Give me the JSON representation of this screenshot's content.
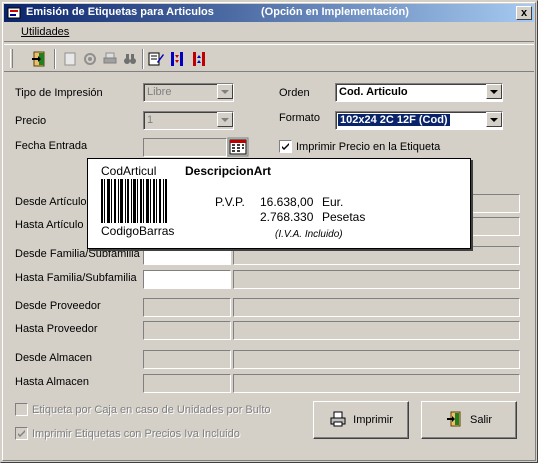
{
  "window": {
    "title": "Emisión de Etiquetas para Articulos",
    "subtitle": "(Opción en Implementación)",
    "close_label": "x"
  },
  "menu": {
    "utilidades": "Utilidades"
  },
  "toolbar": {
    "icons": [
      "exit-icon",
      "new-icon",
      "print-setup-icon",
      "printer-icon",
      "binoculars-icon",
      "edit-icon",
      "move-down-icon",
      "move-up-icon"
    ]
  },
  "form": {
    "tipo_impresion_label": "Tipo de Impresión",
    "tipo_impresion_value": "Libre",
    "precio_label": "Precio",
    "precio_value": "1",
    "fecha_entrada_label": "Fecha Entrada",
    "orden_label": "Orden",
    "orden_value": "Cod. Articulo",
    "formato_label": "Formato",
    "formato_value": "102x24 2C 12F (Cod)",
    "imprimir_precio_label": "Imprimir Precio en la Etiqueta",
    "imprimir_precio_checked": true,
    "desde_articulo_label": "Desde Artículo",
    "hasta_articulo_label": "Hasta Artículo",
    "desde_familia_label": "Desde Familia/Subfamilia",
    "hasta_familia_label": "Hasta Familia/Subfamilia",
    "desde_proveedor_label": "Desde Proveedor",
    "hasta_proveedor_label": "Hasta Proveedor",
    "desde_almacen_label": "Desde Almacen",
    "hasta_almacen_label": "Hasta Almacen",
    "etiqueta_caja_label": "Etiqueta por Caja en caso de Unidades por Bulto",
    "etiqueta_caja_checked": false,
    "imprimir_iva_label": "Imprimir Etiquetas con Precios Iva Incluido",
    "imprimir_iva_checked": true
  },
  "preview": {
    "cod_articulo": "CodArticul",
    "descripcion": "DescripcionArt",
    "codigo_barras": "CodigoBarras",
    "pvp_label": "P.V.P.",
    "price_eur": "16.638,00",
    "currency_eur": "Eur.",
    "price_pts": "2.768.330",
    "currency_pts": "Pesetas",
    "iva_note": "(I.V.A. Incluido)"
  },
  "buttons": {
    "imprimir": "Imprimir",
    "salir": "Salir"
  }
}
